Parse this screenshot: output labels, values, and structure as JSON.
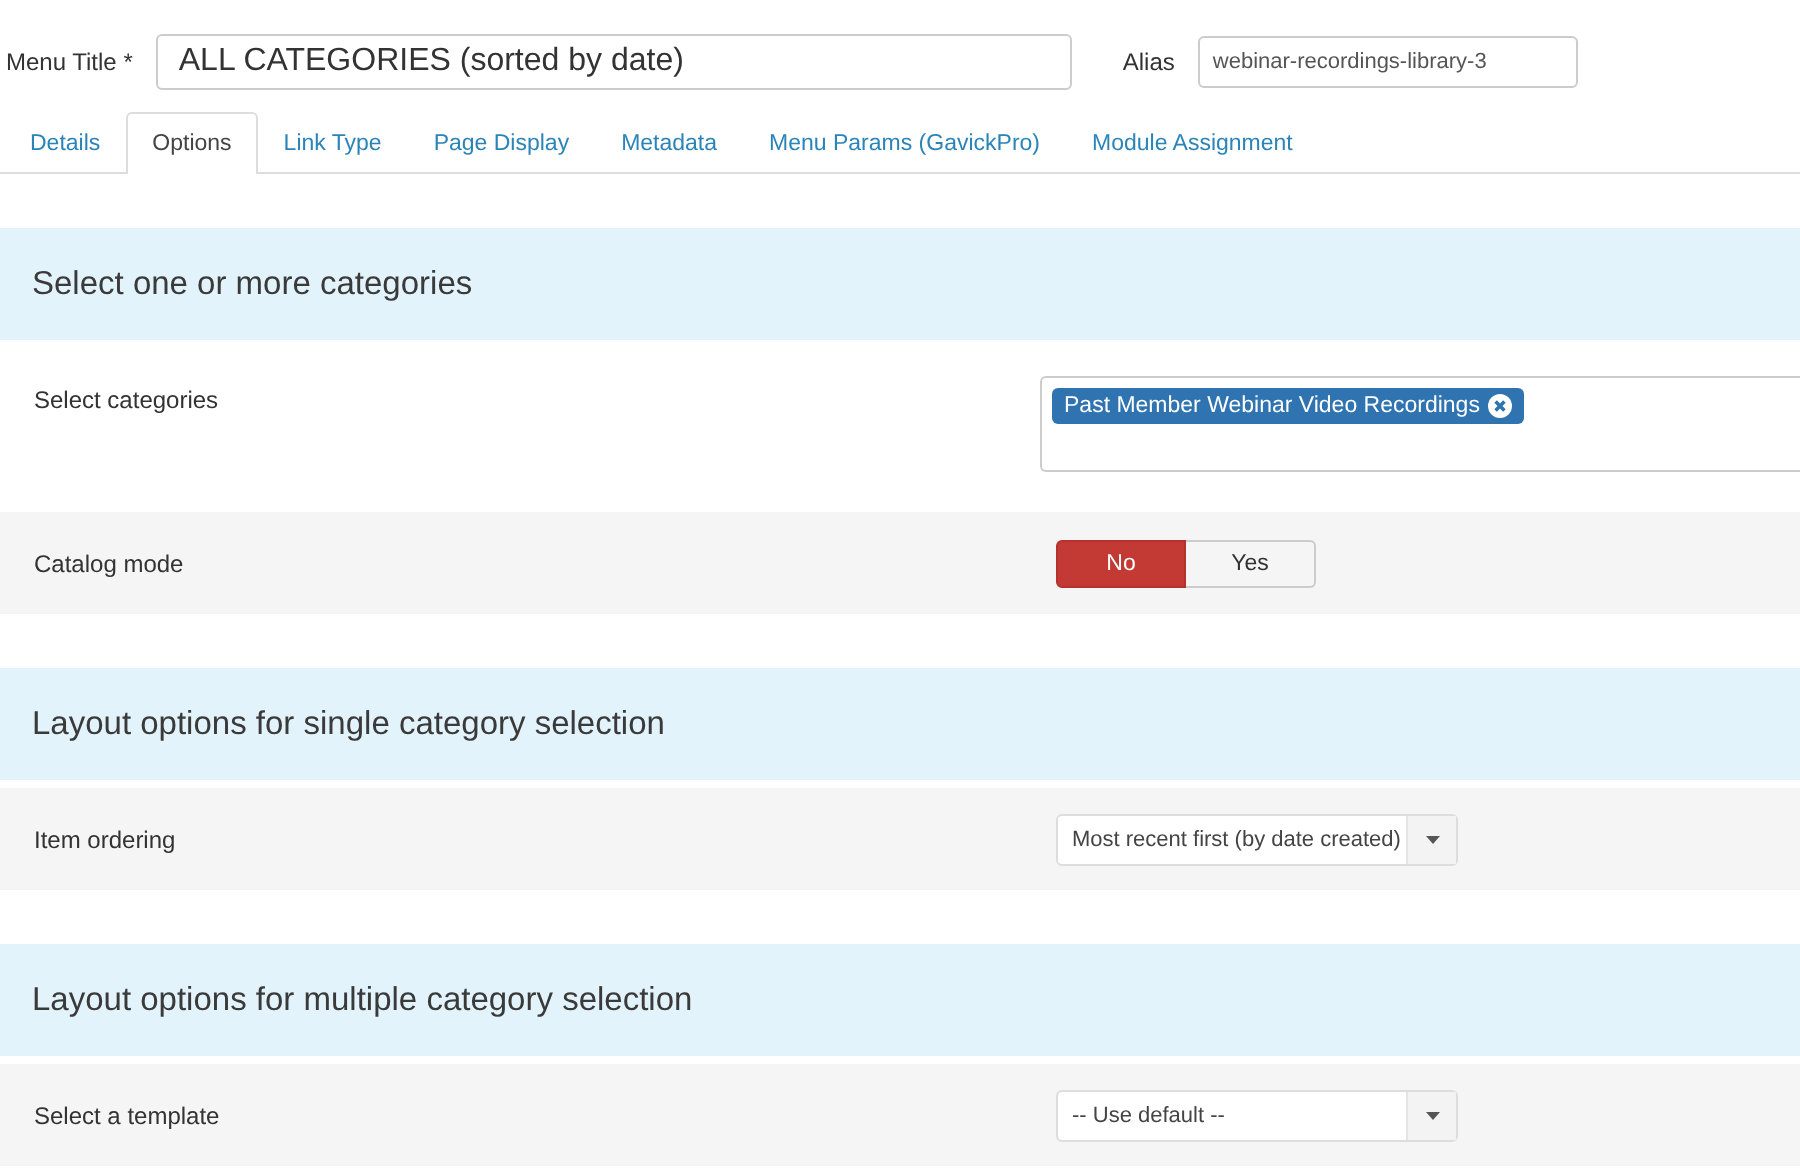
{
  "header": {
    "menu_title_label": "Menu Title *",
    "menu_title_value": "ALL CATEGORIES (sorted by date)",
    "alias_label": "Alias",
    "alias_value": "webinar-recordings-library-3"
  },
  "tabs": [
    {
      "label": "Details",
      "selected": false
    },
    {
      "label": "Options",
      "selected": true
    },
    {
      "label": "Link Type",
      "selected": false
    },
    {
      "label": "Page Display",
      "selected": false
    },
    {
      "label": "Metadata",
      "selected": false
    },
    {
      "label": "Menu Params (GavickPro)",
      "selected": false
    },
    {
      "label": "Module Assignment",
      "selected": false
    }
  ],
  "sections": [
    {
      "title": "Select one or more categories",
      "rows": [
        {
          "kind": "tags",
          "label": "Select categories",
          "tags": [
            "Past Member Webinar Video Recordings"
          ]
        },
        {
          "kind": "toggle",
          "label": "Catalog mode",
          "options": [
            {
              "label": "No",
              "selected": true
            },
            {
              "label": "Yes",
              "selected": false
            }
          ]
        }
      ]
    },
    {
      "title": "Layout options for single category selection",
      "rows": [
        {
          "kind": "select",
          "label": "Item ordering",
          "value": "Most recent first (by date created)"
        }
      ]
    },
    {
      "title": "Layout options for multiple category selection",
      "rows": [
        {
          "kind": "select",
          "label": "Select a template",
          "value": "-- Use default --"
        }
      ]
    }
  ]
}
